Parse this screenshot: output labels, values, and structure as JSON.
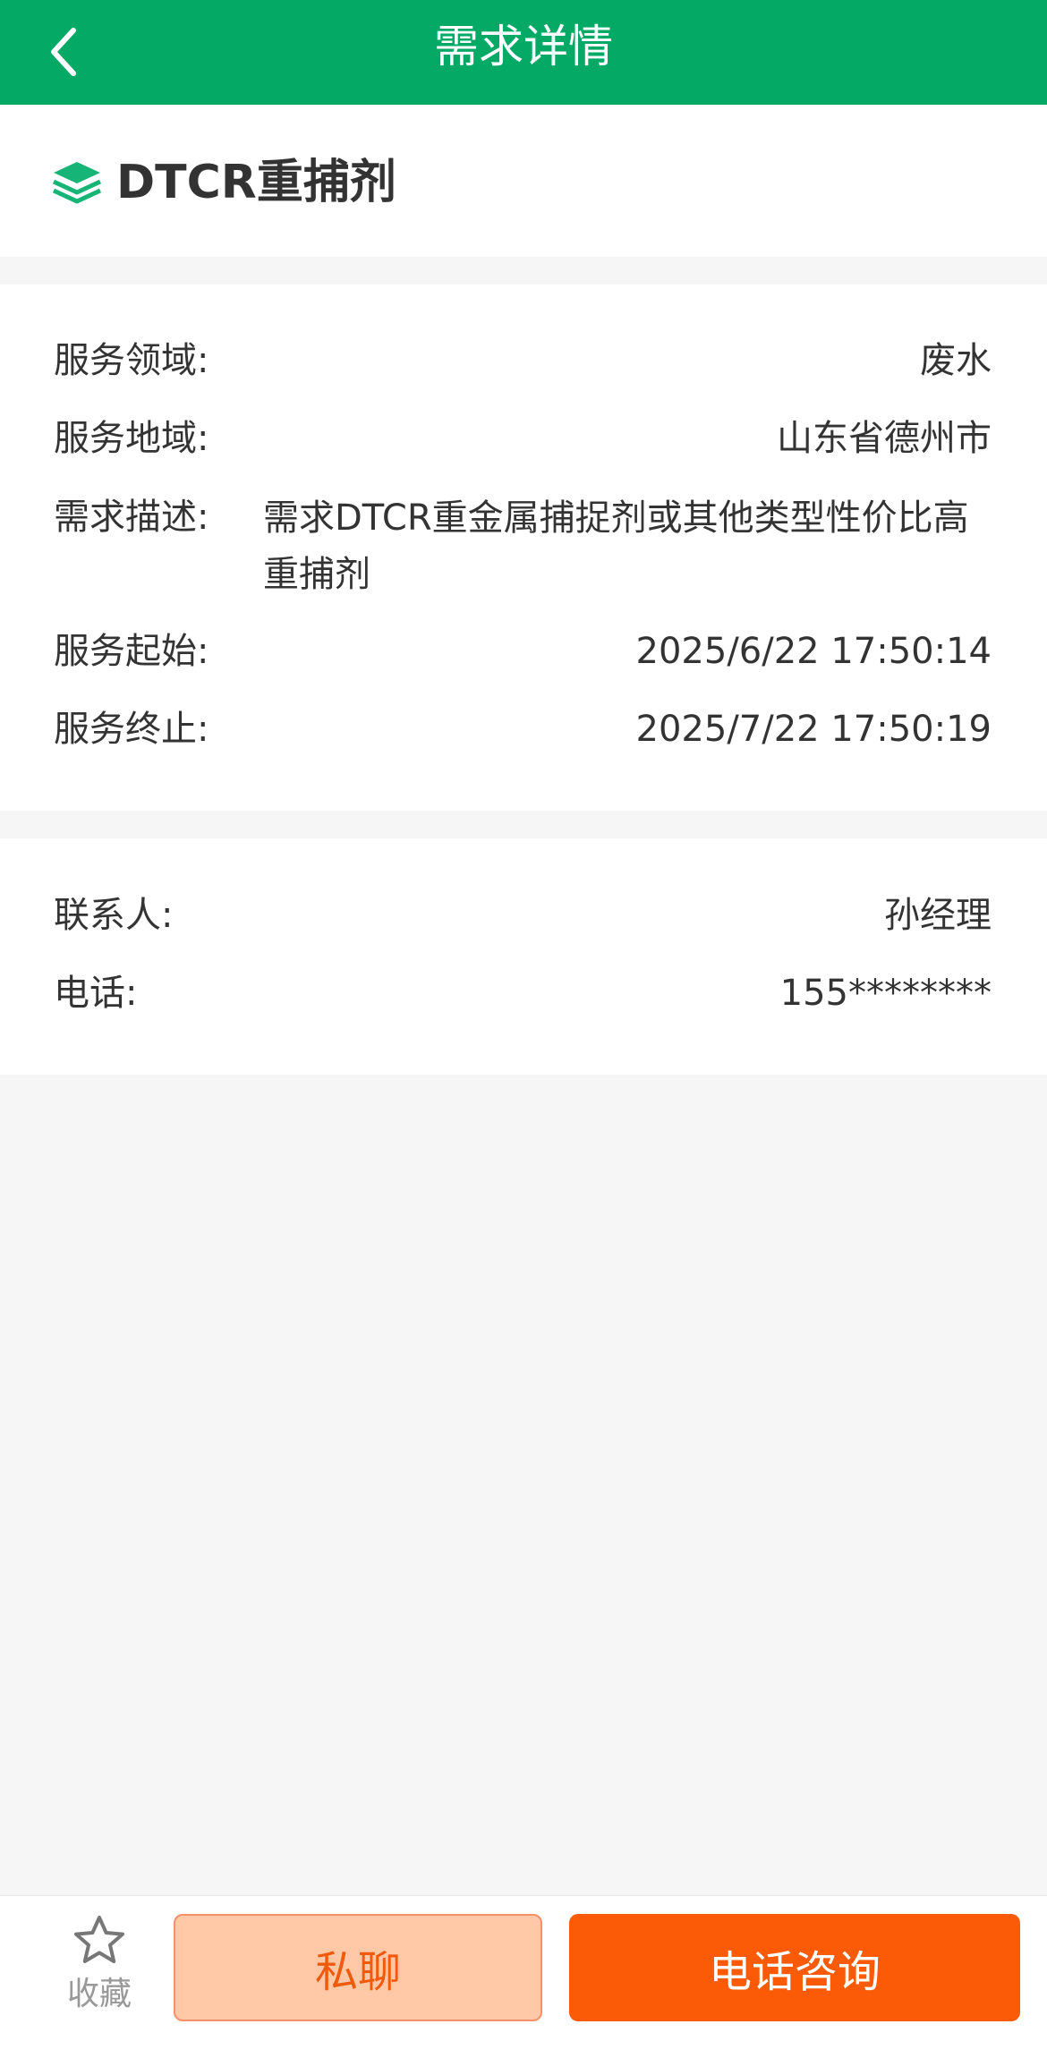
{
  "header": {
    "title": "需求详情",
    "back_icon": "chevron-left-icon"
  },
  "demand": {
    "title": "DTCR重捕剂",
    "icon": "layers-icon",
    "accent": "#03a965"
  },
  "info": [
    {
      "label": "服务领域:",
      "value": "废水"
    },
    {
      "label": "服务地域:",
      "value": "山东省德州市"
    },
    {
      "label": "需求描述:",
      "value": "需求DTCR重金属捕捉剂或其他类型性价比高重捕剂"
    },
    {
      "label": "服务起始:",
      "value": "2025/6/22 17:50:14"
    },
    {
      "label": "服务终止:",
      "value": "2025/7/22 17:50:19"
    }
  ],
  "contact": [
    {
      "label": "联系人:",
      "value": "孙经理"
    },
    {
      "label": "电话:",
      "value": "155********"
    }
  ],
  "bottom": {
    "favorite_label": "收藏",
    "favorite_icon": "star-icon",
    "chat_label": "私聊",
    "call_label": "电话咨询",
    "call_color": "#fb5b06"
  }
}
